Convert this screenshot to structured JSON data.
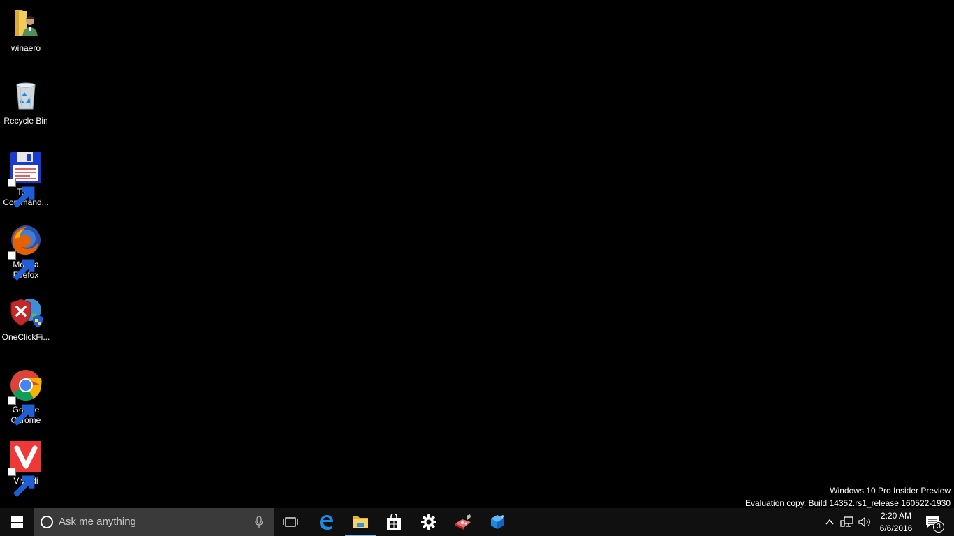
{
  "desktop": {
    "background_color": "#000000",
    "icons": [
      {
        "label": "winaero",
        "icon": "user-folder-icon",
        "shortcut": false
      },
      {
        "label": "Recycle Bin",
        "icon": "recycle-bin-icon",
        "shortcut": false
      },
      {
        "label": "Total Command...",
        "label_line1": "Total",
        "label_line2": "Command...",
        "icon": "total-commander-icon",
        "shortcut": true
      },
      {
        "label": "Mozilla Firefox",
        "label_line1": "Mozilla",
        "label_line2": "Firefox",
        "icon": "firefox-icon",
        "shortcut": true
      },
      {
        "label": "OneClickFi...",
        "icon": "oneclickfirewall-icon",
        "shortcut": false
      },
      {
        "label": "Google Chrome",
        "label_line1": "Google",
        "label_line2": "Chrome",
        "icon": "chrome-icon",
        "shortcut": true
      },
      {
        "label": "Vivaldi",
        "icon": "vivaldi-icon",
        "shortcut": true
      }
    ]
  },
  "watermark": {
    "line1": "Windows 10 Pro Insider Preview",
    "line2": "Evaluation copy. Build 14352.rs1_release.160522-1930"
  },
  "taskbar": {
    "background_color": "#101010",
    "search": {
      "placeholder": "Ask me anything"
    },
    "pinned": [
      {
        "name": "task-view-icon",
        "active": false
      },
      {
        "name": "edge-icon",
        "active": false
      },
      {
        "name": "file-explorer-icon",
        "active": true
      },
      {
        "name": "store-icon",
        "active": false
      },
      {
        "name": "settings-gear-icon",
        "active": false
      },
      {
        "name": "paint-app-icon",
        "active": false
      },
      {
        "name": "app-cube-icon",
        "active": false
      }
    ],
    "accent_color": "#76b9ed",
    "tray": {
      "time": "2:20 AM",
      "date": "6/6/2016",
      "notification_count": "3"
    }
  }
}
